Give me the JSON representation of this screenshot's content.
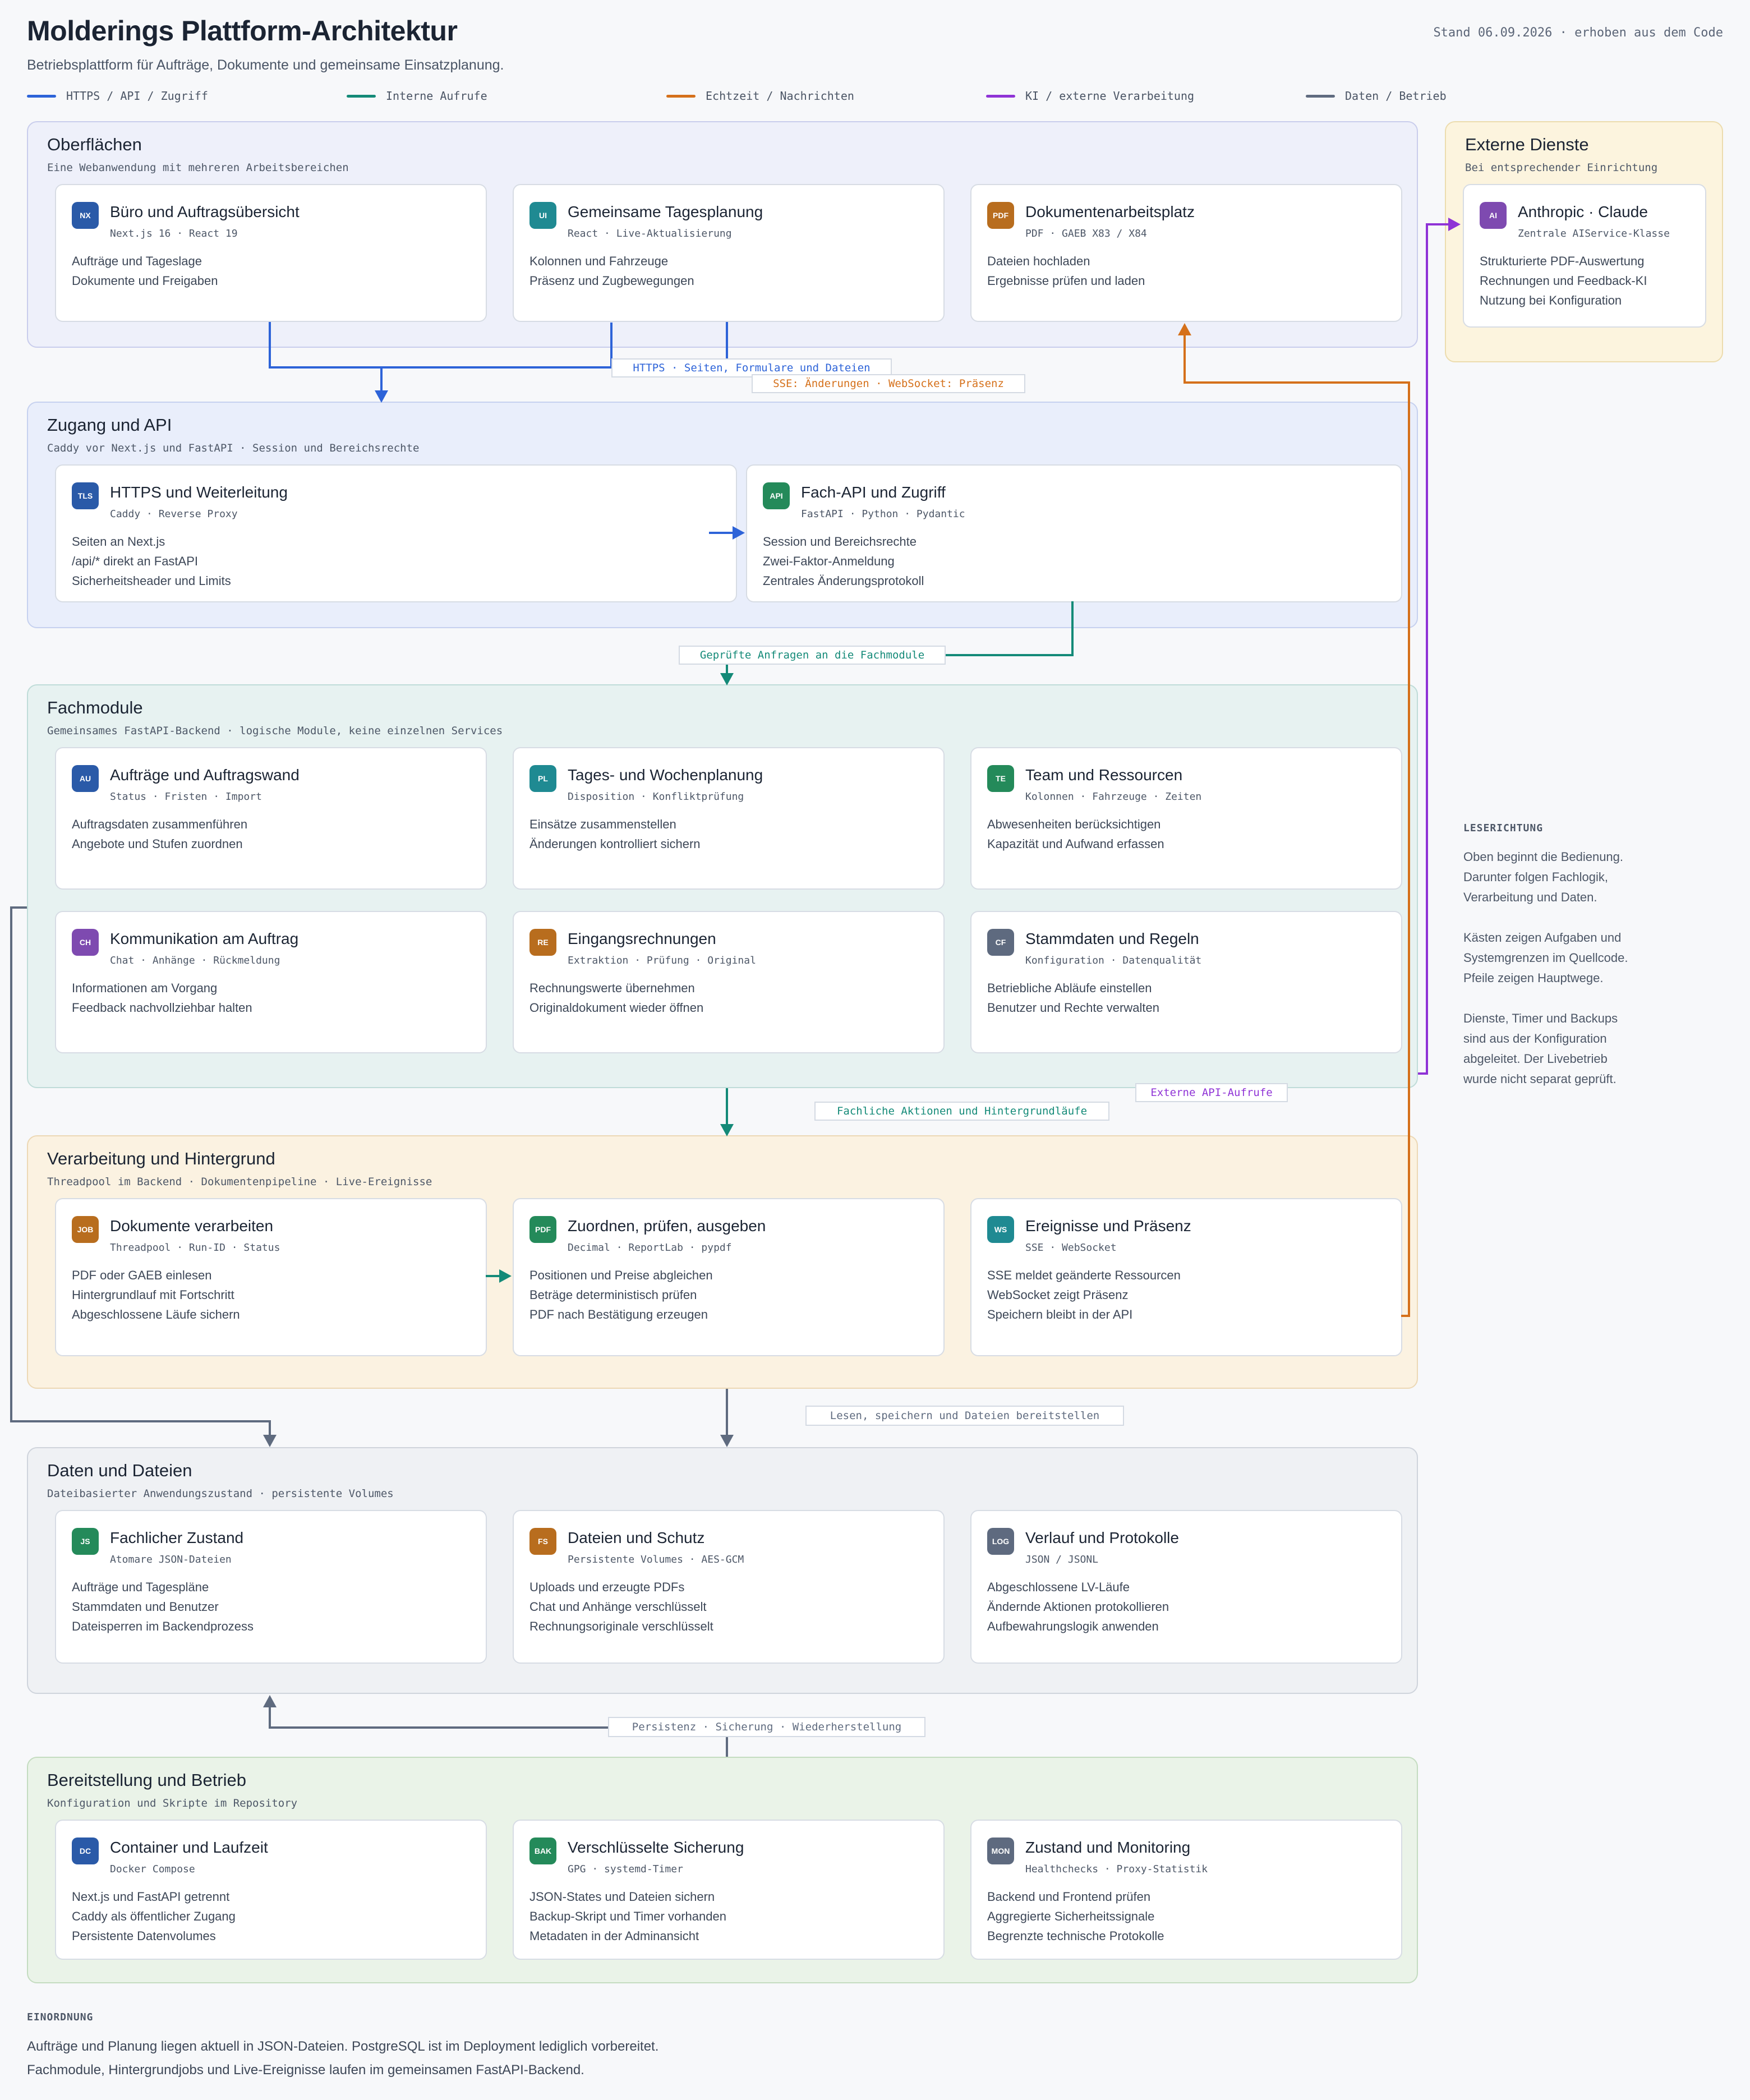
{
  "header": {
    "title": "Molderings Plattform-Architektur",
    "subtitle": "Betriebsplattform für Aufträge, Dokumente und gemeinsame Einsatzplanung.",
    "stand": "Stand 06.09.2026 · erhoben aus dem Code"
  },
  "legend": [
    {
      "label": "HTTPS / API / Zugriff",
      "color": "#2d63d8"
    },
    {
      "label": "Interne Aufrufe",
      "color": "#148a78"
    },
    {
      "label": "Echtzeit / Nachrichten",
      "color": "#d5701a"
    },
    {
      "label": "KI / externe Verarbeitung",
      "color": "#8f33d6"
    },
    {
      "label": "Daten / Betrieb",
      "color": "#5f6b7f"
    }
  ],
  "sections": {
    "oberflaechen": {
      "title": "Oberflächen",
      "subtitle": "Eine Webanwendung mit mehreren Arbeitsbereichen",
      "cards": [
        {
          "badge": "NX",
          "badge_color": "#2a5aa8",
          "title": "Büro und Auftragsübersicht",
          "tech": "Next.js 16 · React 19",
          "lines": [
            "Aufträge und Tageslage",
            "Dokumente und Freigaben"
          ]
        },
        {
          "badge": "UI",
          "badge_color": "#1f8a92",
          "title": "Gemeinsame Tagesplanung",
          "tech": "React · Live-Aktualisierung",
          "lines": [
            "Kolonnen und Fahrzeuge",
            "Präsenz und Zugbewegungen"
          ]
        },
        {
          "badge": "PDF",
          "badge_color": "#b86d1e",
          "title": "Dokumentenarbeitsplatz",
          "tech": "PDF · GAEB X83 / X84",
          "lines": [
            "Dateien hochladen",
            "Ergebnisse prüfen und laden"
          ]
        }
      ]
    },
    "extern": {
      "title": "Externe Dienste",
      "subtitle": "Bei entsprechender Einrichtung",
      "cards": [
        {
          "badge": "AI",
          "badge_color": "#7e4ab0",
          "title": "Anthropic · Claude",
          "tech": "Zentrale AIService-Klasse",
          "lines": [
            "Strukturierte PDF-Auswertung",
            "Rechnungen und Feedback-KI",
            "Nutzung bei Konfiguration"
          ]
        }
      ]
    },
    "zugang": {
      "title": "Zugang und API",
      "subtitle": "Caddy vor Next.js und FastAPI · Session und Bereichsrechte",
      "cards": [
        {
          "badge": "TLS",
          "badge_color": "#2a5aa8",
          "title": "HTTPS und Weiterleitung",
          "tech": "Caddy · Reverse Proxy",
          "lines": [
            "Seiten an Next.js",
            "/api/* direkt an FastAPI",
            "Sicherheitsheader und Limits"
          ]
        },
        {
          "badge": "API",
          "badge_color": "#248a5a",
          "title": "Fach-API und Zugriff",
          "tech": "FastAPI · Python · Pydantic",
          "lines": [
            "Session und Bereichsrechte",
            "Zwei-Faktor-Anmeldung",
            "Zentrales Änderungsprotokoll"
          ]
        }
      ]
    },
    "fachmodule": {
      "title": "Fachmodule",
      "subtitle": "Gemeinsames FastAPI-Backend · logische Module, keine einzelnen Services",
      "cards": [
        {
          "badge": "AU",
          "badge_color": "#2a5aa8",
          "title": "Aufträge und Auftragswand",
          "tech": "Status · Fristen · Import",
          "lines": [
            "Auftragsdaten zusammenführen",
            "Angebote und Stufen zuordnen"
          ]
        },
        {
          "badge": "PL",
          "badge_color": "#1f8a92",
          "title": "Tages- und Wochenplanung",
          "tech": "Disposition · Konfliktprüfung",
          "lines": [
            "Einsätze zusammenstellen",
            "Änderungen kontrolliert sichern"
          ]
        },
        {
          "badge": "TE",
          "badge_color": "#248a5a",
          "title": "Team und Ressourcen",
          "tech": "Kolonnen · Fahrzeuge · Zeiten",
          "lines": [
            "Abwesenheiten berücksichtigen",
            "Kapazität und Aufwand erfassen"
          ]
        },
        {
          "badge": "CH",
          "badge_color": "#7e4ab0",
          "title": "Kommunikation am Auftrag",
          "tech": "Chat · Anhänge · Rückmeldung",
          "lines": [
            "Informationen am Vorgang",
            "Feedback nachvollziehbar halten"
          ]
        },
        {
          "badge": "RE",
          "badge_color": "#b86d1e",
          "title": "Eingangsrechnungen",
          "tech": "Extraktion · Prüfung · Original",
          "lines": [
            "Rechnungswerte übernehmen",
            "Originaldokument wieder öffnen"
          ]
        },
        {
          "badge": "CF",
          "badge_color": "#5e6a7f",
          "title": "Stammdaten und Regeln",
          "tech": "Konfiguration · Datenqualität",
          "lines": [
            "Betriebliche Abläufe einstellen",
            "Benutzer und Rechte verwalten"
          ]
        }
      ]
    },
    "verarbeitung": {
      "title": "Verarbeitung und Hintergrund",
      "subtitle": "Threadpool im Backend · Dokumentenpipeline · Live-Ereignisse",
      "cards": [
        {
          "badge": "JOB",
          "badge_color": "#b86d1e",
          "title": "Dokumente verarbeiten",
          "tech": "Threadpool · Run-ID · Status",
          "lines": [
            "PDF oder GAEB einlesen",
            "Hintergrundlauf mit Fortschritt",
            "Abgeschlossene Läufe sichern"
          ]
        },
        {
          "badge": "PDF",
          "badge_color": "#248a5a",
          "title": "Zuordnen, prüfen, ausgeben",
          "tech": "Decimal · ReportLab · pypdf",
          "lines": [
            "Positionen und Preise abgleichen",
            "Beträge deterministisch prüfen",
            "PDF nach Bestätigung erzeugen"
          ]
        },
        {
          "badge": "WS",
          "badge_color": "#1f8a92",
          "title": "Ereignisse und Präsenz",
          "tech": "SSE · WebSocket",
          "lines": [
            "SSE meldet geänderte Ressourcen",
            "WebSocket zeigt Präsenz",
            "Speichern bleibt in der API"
          ]
        }
      ]
    },
    "daten": {
      "title": "Daten und Dateien",
      "subtitle": "Dateibasierter Anwendungszustand · persistente Volumes",
      "cards": [
        {
          "badge": "JS",
          "badge_color": "#248a5a",
          "title": "Fachlicher Zustand",
          "tech": "Atomare JSON-Dateien",
          "lines": [
            "Aufträge und Tagespläne",
            "Stammdaten und Benutzer",
            "Dateisperren im Backendprozess"
          ]
        },
        {
          "badge": "FS",
          "badge_color": "#b86d1e",
          "title": "Dateien und Schutz",
          "tech": "Persistente Volumes · AES-GCM",
          "lines": [
            "Uploads und erzeugte PDFs",
            "Chat und Anhänge verschlüsselt",
            "Rechnungsoriginale verschlüsselt"
          ]
        },
        {
          "badge": "LOG",
          "badge_color": "#5e6a7f",
          "title": "Verlauf und Protokolle",
          "tech": "JSON / JSONL",
          "lines": [
            "Abgeschlossene LV-Läufe",
            "Ändernde Aktionen protokollieren",
            "Aufbewahrungslogik anwenden"
          ]
        }
      ]
    },
    "betrieb": {
      "title": "Bereitstellung und Betrieb",
      "subtitle": "Konfiguration und Skripte im Repository",
      "cards": [
        {
          "badge": "DC",
          "badge_color": "#2a5aa8",
          "title": "Container und Laufzeit",
          "tech": "Docker Compose",
          "lines": [
            "Next.js und FastAPI getrennt",
            "Caddy als öffentlicher Zugang",
            "Persistente Datenvolumes"
          ]
        },
        {
          "badge": "BAK",
          "badge_color": "#248a5a",
          "title": "Verschlüsselte Sicherung",
          "tech": "GPG · systemd-Timer",
          "lines": [
            "JSON-States und Dateien sichern",
            "Backup-Skript und Timer vorhanden",
            "Metadaten in der Adminansicht"
          ]
        },
        {
          "badge": "MON",
          "badge_color": "#5e6a7f",
          "title": "Zustand und Monitoring",
          "tech": "Healthchecks · Proxy-Statistik",
          "lines": [
            "Backend und Frontend prüfen",
            "Aggregierte Sicherheitssignale",
            "Begrenzte technische Protokolle"
          ]
        }
      ]
    }
  },
  "edge_labels": {
    "https": "HTTPS · Seiten, Formulare und Dateien",
    "sse": "SSE: Änderungen · WebSocket: Präsenz",
    "gepruefte": "Geprüfte Anfragen an die Fachmodule",
    "fachliche": "Fachliche Aktionen und Hintergrundläufe",
    "externe": "Externe API-Aufrufe",
    "lesen": "Lesen, speichern und Dateien bereitstellen",
    "persistenz": "Persistenz · Sicherung · Wiederherstellung"
  },
  "side_note": {
    "heading": "LESERICHTUNG",
    "paragraphs": [
      [
        "Oben beginnt die Bedienung.",
        "Darunter folgen Fachlogik,",
        "Verarbeitung und Daten."
      ],
      [
        "Kästen zeigen Aufgaben und",
        "Systemgrenzen im Quellcode.",
        "Pfeile zeigen Hauptwege."
      ],
      [
        "Dienste, Timer und Backups",
        "sind aus der Konfiguration",
        "abgeleitet. Der Livebetrieb",
        "wurde nicht separat geprüft."
      ]
    ]
  },
  "footer": {
    "heading": "EINORDNUNG",
    "lines": [
      "Aufträge und Planung liegen aktuell in JSON-Dateien. PostgreSQL ist im Deployment lediglich vorbereitet.",
      "Fachmodule, Hintergrundjobs und Live-Ereignisse laufen im gemeinsamen FastAPI-Backend."
    ]
  }
}
